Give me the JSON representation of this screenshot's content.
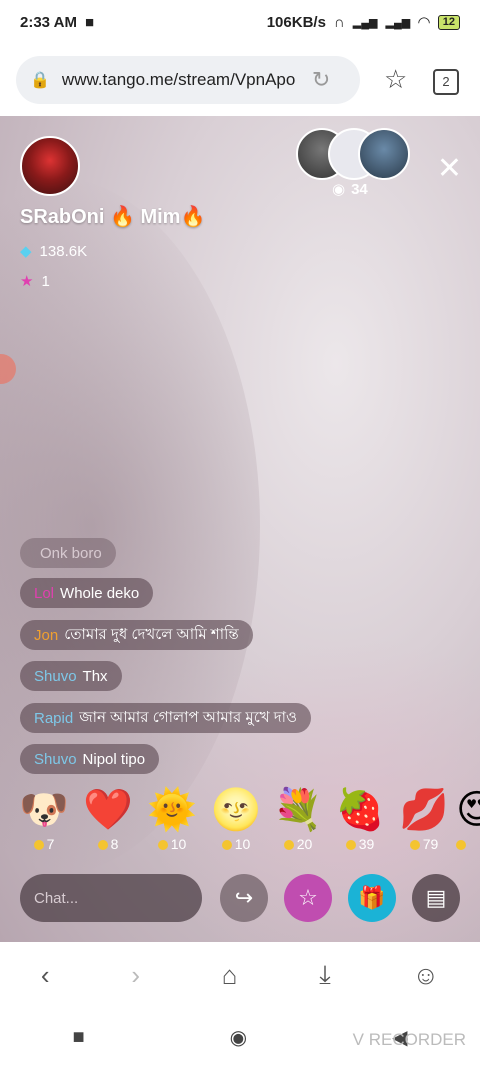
{
  "status_bar": {
    "time": "2:33 AM",
    "network_speed": "106KB/s",
    "battery": "12"
  },
  "browser": {
    "url": "www.tango.me/stream/VpnApo",
    "tab_count": "2"
  },
  "stream": {
    "host_name": "SRabOni 🔥 Mim🔥",
    "diamonds": "138.6K",
    "stars": "1",
    "viewer_count": "34",
    "chat_placeholder": "Chat...",
    "messages": [
      {
        "user": "",
        "text": "Onk boro",
        "user_color": "#e8a0c0"
      },
      {
        "user": "Lol",
        "text": "Whole deko",
        "user_color": "#e040b0"
      },
      {
        "user": "Jon",
        "text": "তোমার দুধ দেখলে আমি শান্তি",
        "user_color": "#f0a030"
      },
      {
        "user": "Shuvo",
        "text": "Thx",
        "user_color": "#7ec8e8"
      },
      {
        "user": "Rapid",
        "text": "জান আমার গোলাপ আমার মুখে দাও",
        "user_color": "#7ec8e8"
      },
      {
        "user": "Shuvo",
        "text": "Nipol tipo",
        "user_color": "#7ec8e8"
      }
    ],
    "gifts": [
      {
        "icon": "puppy-icon",
        "emoji": "🐶",
        "price": "7"
      },
      {
        "icon": "heart-icon",
        "emoji": "❤️",
        "price": "8"
      },
      {
        "icon": "sun-icon",
        "emoji": "🌞",
        "price": "10"
      },
      {
        "icon": "moon-icon",
        "emoji": "🌝",
        "price": "10"
      },
      {
        "icon": "flowers-icon",
        "emoji": "💐",
        "price": "20"
      },
      {
        "icon": "strawberry-icon",
        "emoji": "🍓",
        "price": "39"
      },
      {
        "icon": "lips-icon",
        "emoji": "💋",
        "price": "79"
      }
    ]
  },
  "watermark": "V RECORDER"
}
